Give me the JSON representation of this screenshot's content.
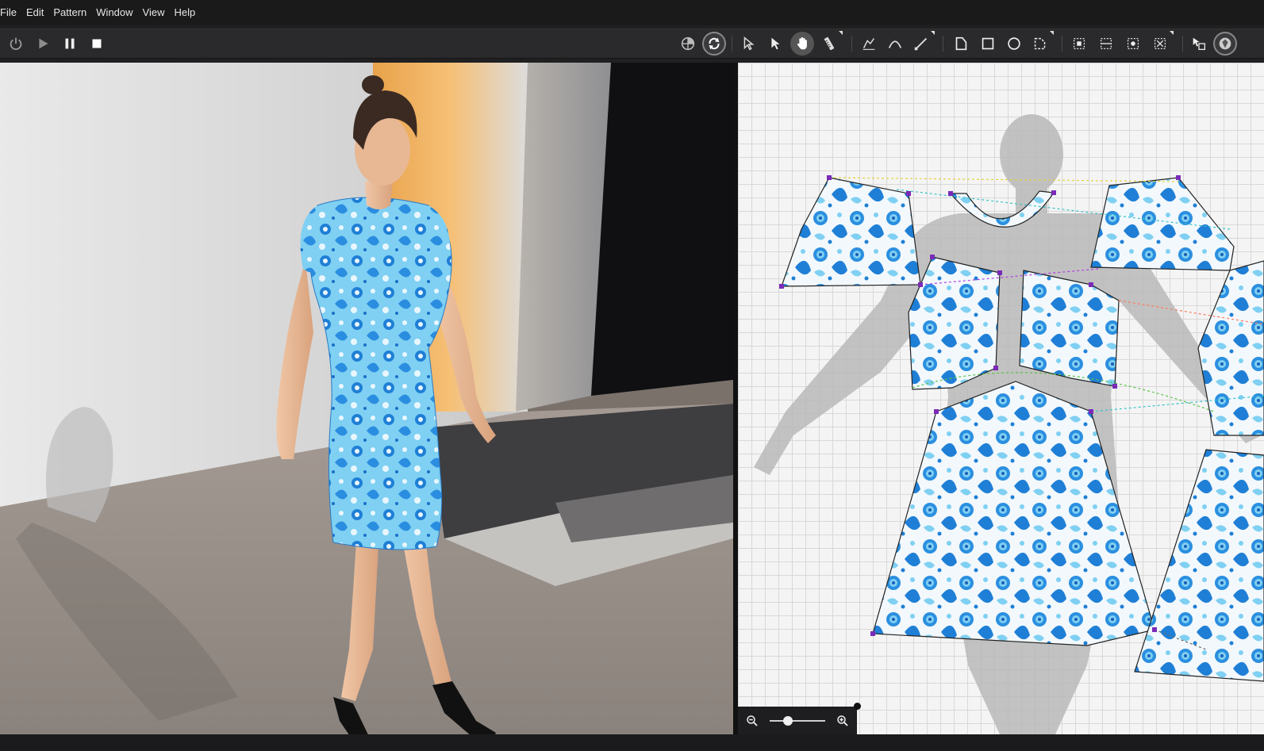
{
  "menubar": {
    "items": [
      "File",
      "Edit",
      "Pattern",
      "Window",
      "View",
      "Help"
    ]
  },
  "toolbar": {
    "simulation": [
      {
        "name": "power-icon"
      },
      {
        "name": "play-icon"
      },
      {
        "name": "pause-icon"
      },
      {
        "name": "stop-icon"
      }
    ],
    "tools": [
      "globe-icon",
      "sync-icon",
      "select-arrow-icon",
      "transform-arrow-icon",
      "hand-icon",
      "tape-measure-icon",
      "seam-icon",
      "curve-icon",
      "pen-icon",
      "polygon-icon",
      "rectangle-icon",
      "circle-icon",
      "internal-shape-icon",
      "sew-segment-icon",
      "sew-free-icon",
      "sew-multi-icon",
      "sew-check-icon",
      "avatar-toggle-icon",
      "texture-icon"
    ]
  },
  "zoom": {
    "level": 0.3
  },
  "colors": {
    "accent_blue": "#1f7fd6",
    "fabric_light": "#7fd0f2",
    "fabric_white": "#f2f8fc",
    "avatar_gray": "#b9b9b9"
  }
}
